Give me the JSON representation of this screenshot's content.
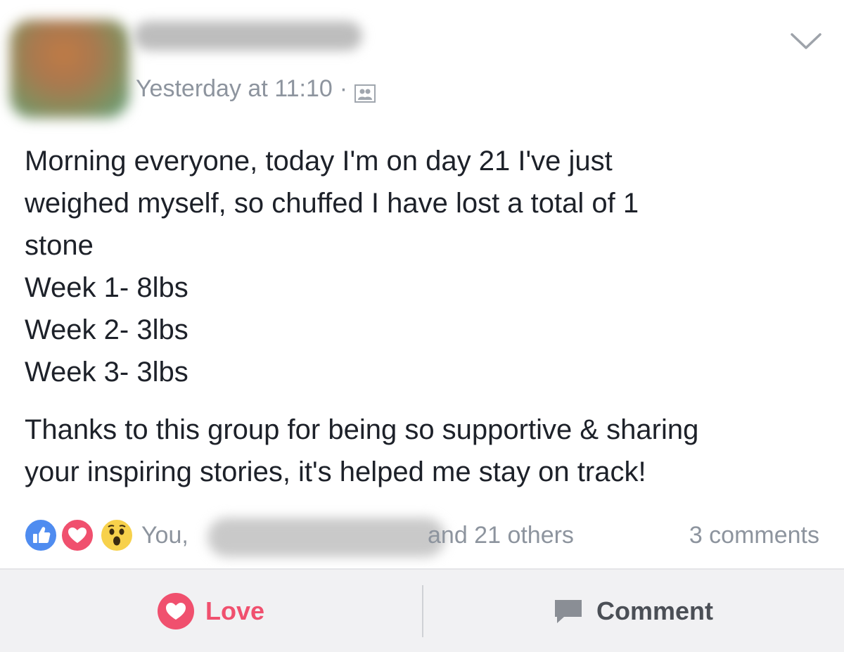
{
  "post": {
    "timestamp": "Yesterday at 11:10",
    "separator": "·",
    "audience_icon": "group-icon",
    "menu_icon": "chevron-down-icon",
    "body": {
      "line1": "Morning everyone, today I'm on day 21 I've just",
      "line2": "weighed myself, so chuffed I have lost a total of 1",
      "line3": "stone",
      "line4": "Week 1- 8lbs",
      "line5": "Week 2- 3lbs",
      "line6": "Week 3- 3lbs",
      "line7": "Thanks to this group for being so supportive & sharing",
      "line8": "your inspiring stories, it's helped me stay on track!"
    }
  },
  "reactions": {
    "icons": [
      "like-icon",
      "love-icon",
      "wow-icon"
    ],
    "you_label": "You,",
    "others_label": "and 21 others",
    "comments_label": "3 comments"
  },
  "actions": {
    "love_label": "Love",
    "comment_label": "Comment"
  },
  "colors": {
    "like": "#4f8cf0",
    "love": "#f0506e",
    "wow": "#f7d14b",
    "meta_text": "#8d949e",
    "body_text": "#1d2129",
    "action_bar": "#f1f1f3"
  }
}
